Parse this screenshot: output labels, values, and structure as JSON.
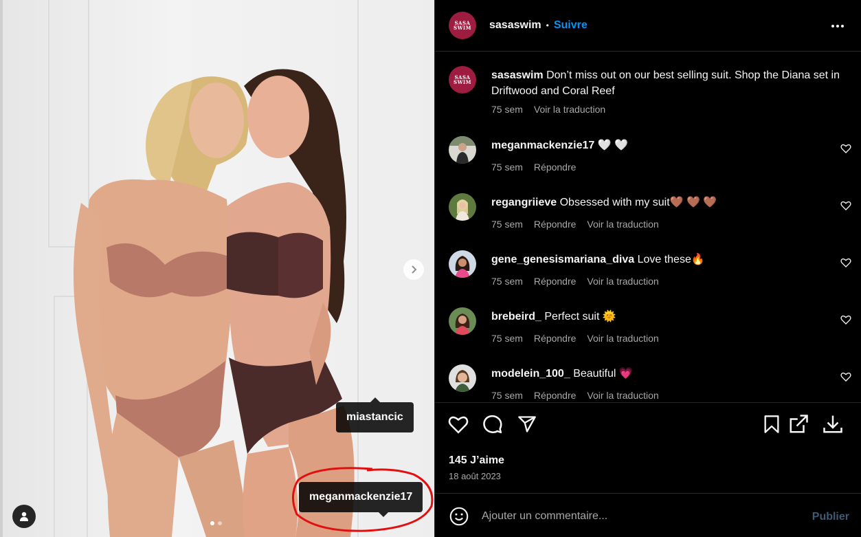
{
  "post": {
    "author": "sasaswim",
    "brand_logo_text": "SASA SWIM",
    "follow_label": "Suivre",
    "separator": "•",
    "caption": "Don’t miss out on our best selling suit. Shop the Diana set in Driftwood and Coral Reef",
    "caption_time": "75 sem",
    "caption_translate": "Voir la traduction"
  },
  "media": {
    "photo_tags": [
      "miastancic",
      "meganmackenzie17"
    ],
    "carousel_count": 2,
    "carousel_active": 1
  },
  "comments": [
    {
      "user": "meganmackenzie17",
      "text": "🤍 🤍",
      "time": "75 sem",
      "reply": "Répondre",
      "translate": ""
    },
    {
      "user": "regangriieve",
      "text": "Obsessed with my suit🤎 🤎 🤎",
      "time": "75 sem",
      "reply": "Répondre",
      "translate": "Voir la traduction"
    },
    {
      "user": "gene_genesismariana_diva",
      "text": "Love these🔥",
      "time": "75 sem",
      "reply": "Répondre",
      "translate": "Voir la traduction"
    },
    {
      "user": "brebeird_",
      "text": "Perfect suit 🌞",
      "time": "75 sem",
      "reply": "Répondre",
      "translate": "Voir la traduction"
    },
    {
      "user": "modelein_100_",
      "text": "Beautiful 💗",
      "time": "75 sem",
      "reply": "Répondre",
      "translate": "Voir la traduction"
    }
  ],
  "stats": {
    "likes": "145 J’aime",
    "date": "18 août 2023"
  },
  "add_comment": {
    "placeholder": "Ajouter un commentaire...",
    "publish_label": "Publier"
  },
  "colors": {
    "accent": "#0095f6",
    "brand": "#9e1c3f",
    "background": "#000000",
    "secondary_text": "#a8a8a8",
    "annotation": "#e01010"
  },
  "icons": [
    "more-icon",
    "heart-icon",
    "comment-icon",
    "share-icon",
    "bookmark-icon",
    "external-link-icon",
    "download-icon",
    "emoji-icon",
    "chevron-right-icon",
    "user-tag-icon"
  ]
}
